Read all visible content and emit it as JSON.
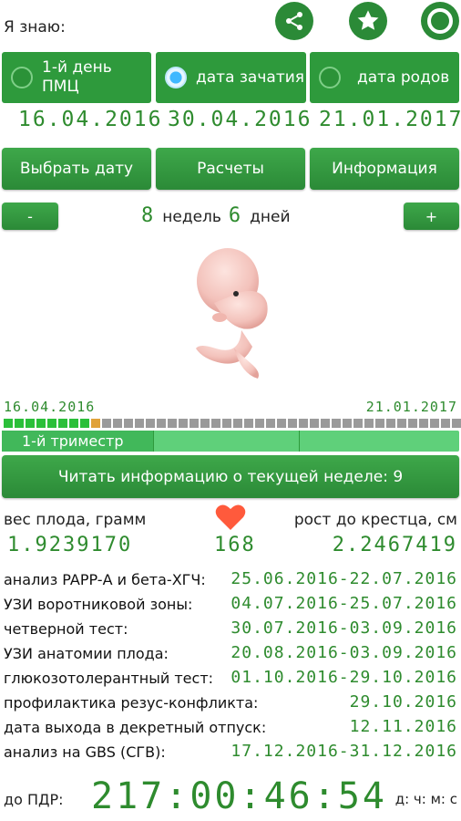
{
  "header": {
    "label": "Я знаю:"
  },
  "icons": {
    "share": "share-icon",
    "star": "star-icon",
    "ring": "ring-icon"
  },
  "mode_tabs": [
    {
      "label": "1-й день\nПМЦ",
      "date": "16.04.2016",
      "selected": false
    },
    {
      "label": "дата зачатия",
      "date": "30.04.2016",
      "selected": true
    },
    {
      "label": "дата родов",
      "date": "21.01.2017",
      "selected": false
    }
  ],
  "actions": {
    "choose_date": "Выбрать дату",
    "calc": "Расчеты",
    "info": "Информация"
  },
  "week_counter": {
    "minus": "-",
    "plus": "+",
    "weeks": "8",
    "weeks_label": "недель",
    "days": "6",
    "days_label": "дней"
  },
  "timeline": {
    "start": "16.04.2016",
    "end": "21.01.2017",
    "filled_segments": 9,
    "current_segment": 1,
    "total_segments": 42
  },
  "trimester": {
    "label": "1-й триместр",
    "progress": 0.33
  },
  "read_button": "Читать информацию о текущей неделе: 9",
  "stats": {
    "weight_label": "вес плода, грамм",
    "weight_value": "1.9239170",
    "heart_value": "168",
    "length_label": "рост до крестца, см",
    "length_value": "2.2467419"
  },
  "schedule": [
    {
      "label": "анализ PAPP-А и бета-ХГЧ:",
      "value": "25.06.2016-22.07.2016"
    },
    {
      "label": "УЗИ воротниковой зоны:",
      "value": "04.07.2016-25.07.2016"
    },
    {
      "label": "четверной тест:",
      "value": "30.07.2016-03.09.2016"
    },
    {
      "label": "УЗИ анатомии плода:",
      "value": "20.08.2016-03.09.2016"
    },
    {
      "label": "глюкозотолерантный тест:",
      "value": "01.10.2016-29.10.2016"
    },
    {
      "label": "профилактика резус-конфликта:",
      "value": "29.10.2016"
    },
    {
      "label": "дата выхода в декретный отпуск:",
      "value": "12.11.2016"
    },
    {
      "label": "анализ на GBS (СГВ):",
      "value": "17.12.2016-31.12.2016"
    }
  ],
  "countdown": {
    "label": "до ПДР:",
    "value": "217:00:46:54",
    "units": "д: ч: м: с"
  },
  "colors": {
    "accent": "#2e9a3c",
    "lcd": "#2e8b2e",
    "heart": "#ff5a3c"
  }
}
